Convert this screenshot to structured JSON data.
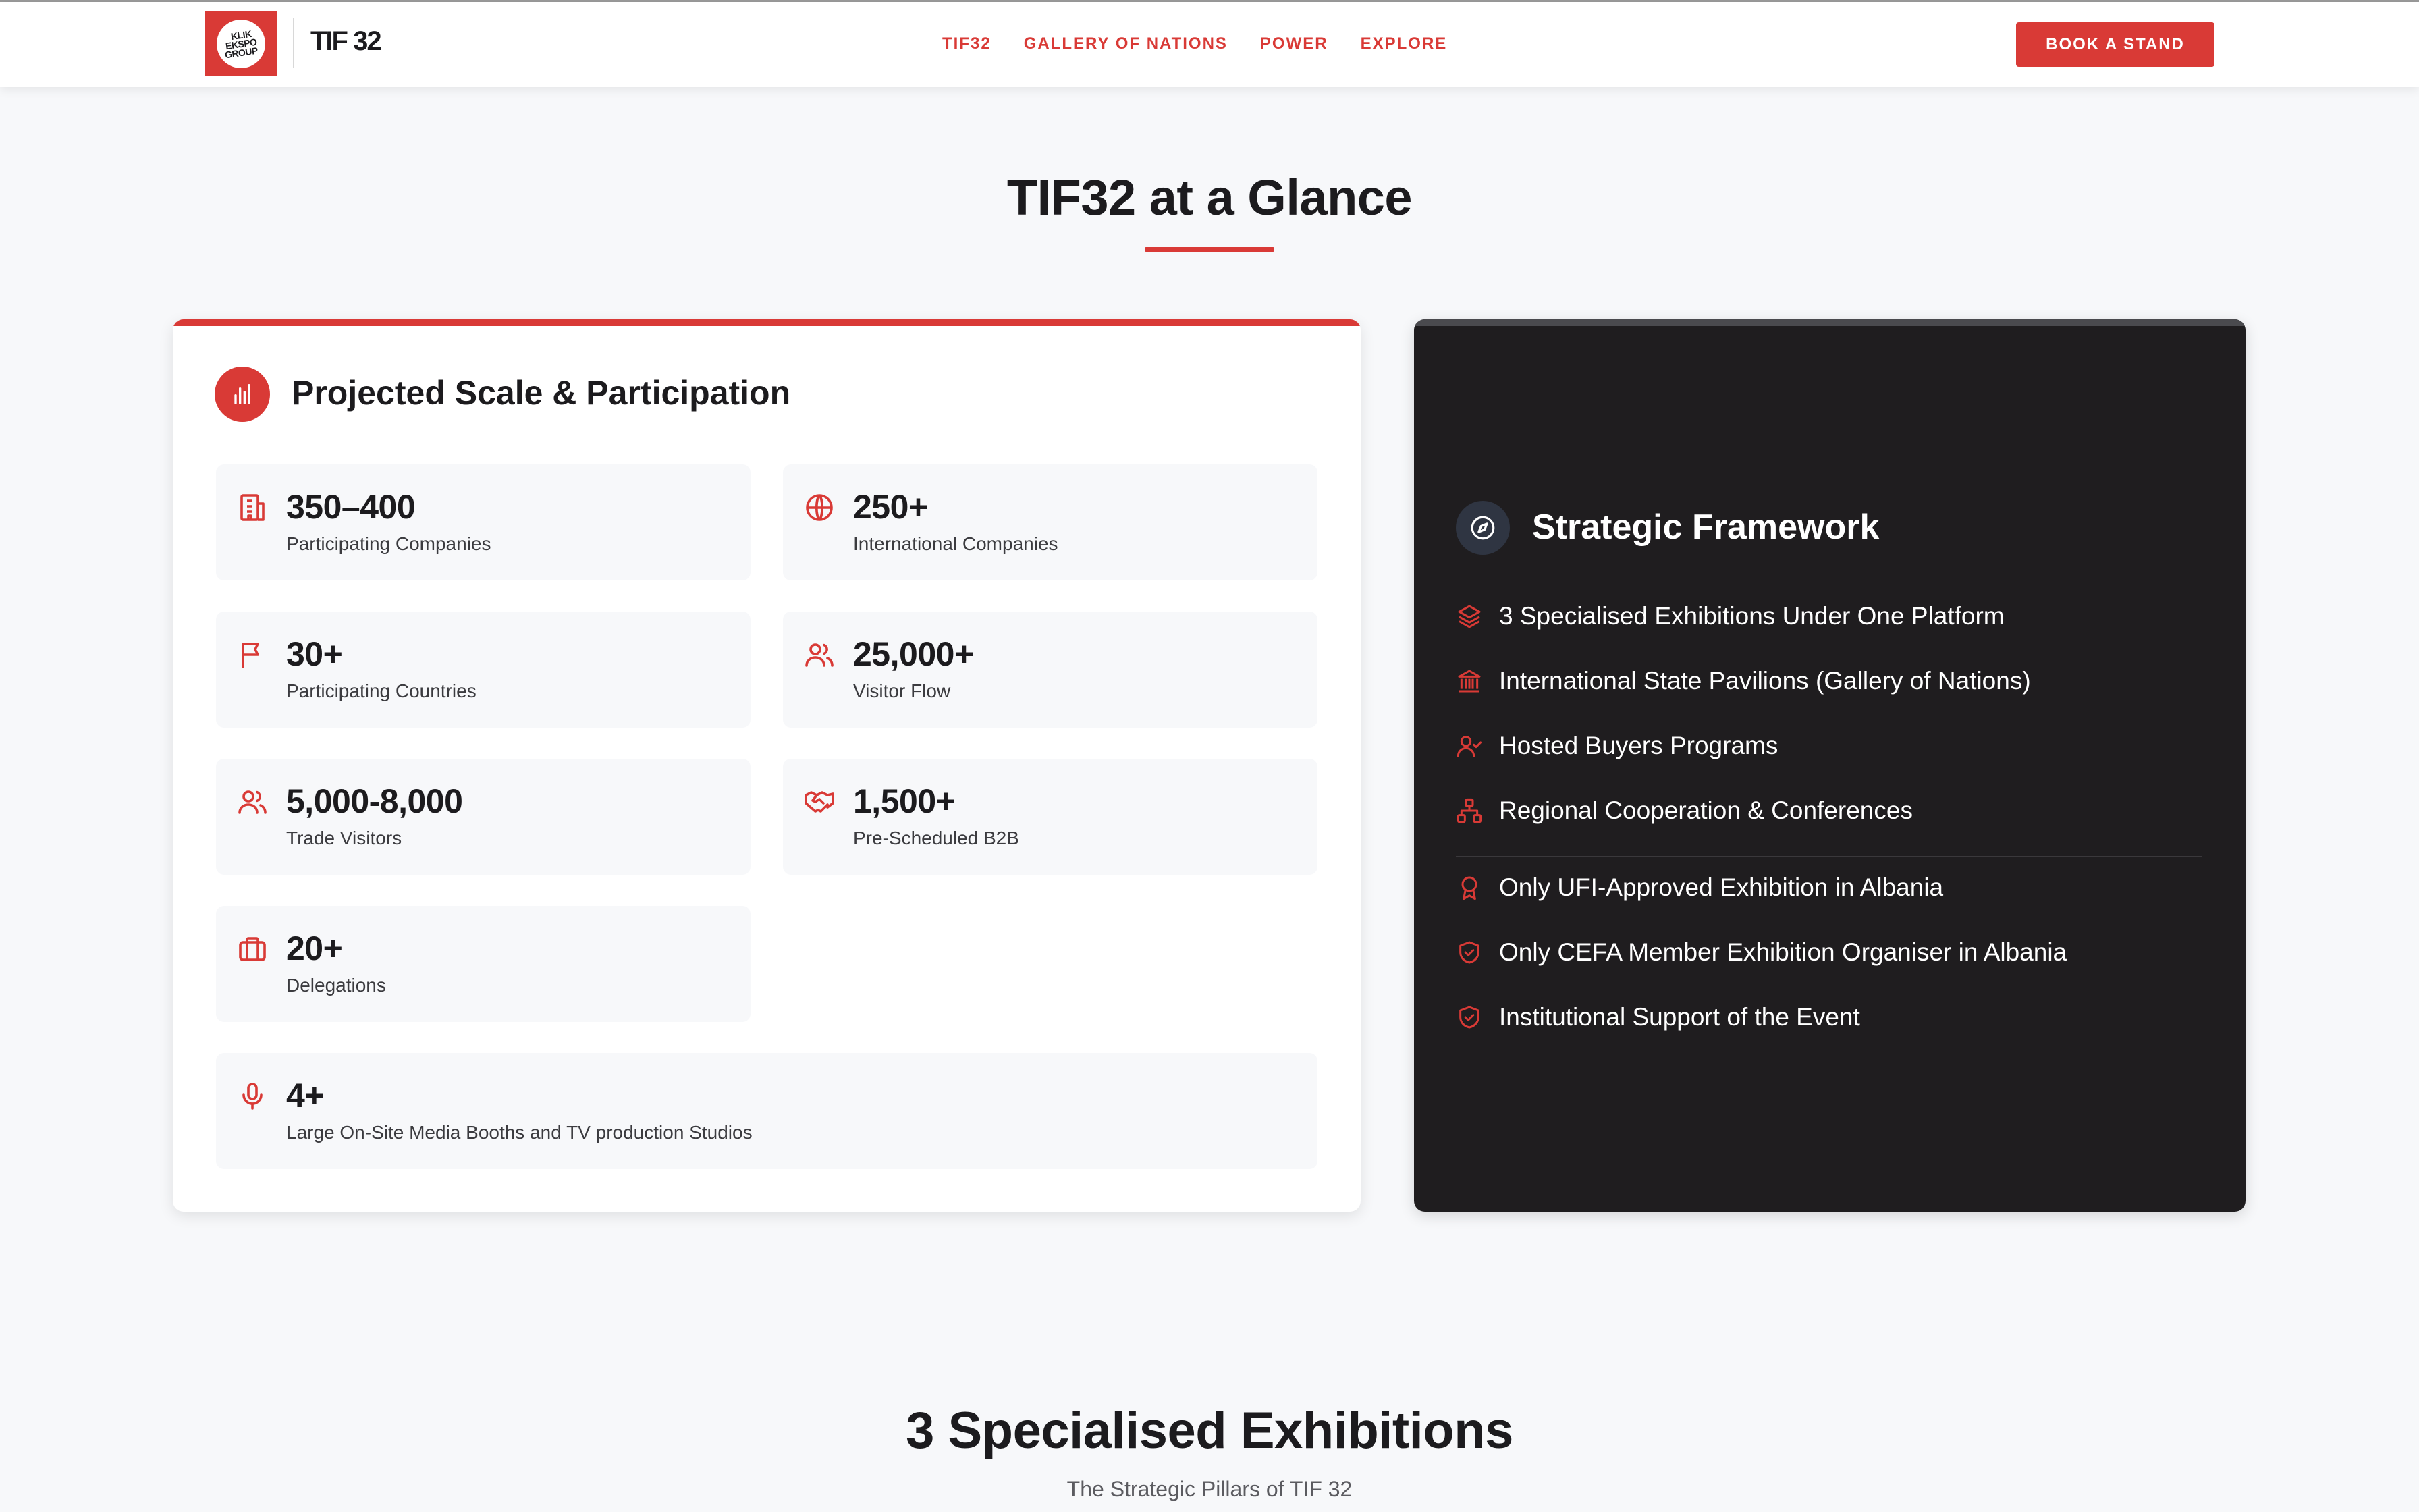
{
  "header": {
    "logo_lines": [
      "KLIK",
      "EKSPO",
      "GROUP"
    ],
    "brand": "TIF 32",
    "nav": [
      "TIF32",
      "GALLERY OF NATIONS",
      "POWER",
      "EXPLORE"
    ],
    "cta": "BOOK A STAND"
  },
  "glance": {
    "title": "TIF32 at a Glance",
    "accent_color": "#d93a36"
  },
  "scale_card": {
    "title": "Projected Scale & Participation",
    "icon": "bar-chart-icon",
    "stats": [
      {
        "value": "350–400",
        "label": "Participating Companies",
        "icon": "building-icon"
      },
      {
        "value": "250+",
        "label": "International Companies",
        "icon": "globe-icon"
      },
      {
        "value": "30+",
        "label": "Participating Countries",
        "icon": "flag-icon"
      },
      {
        "value": "25,000+",
        "label": "Visitor Flow",
        "icon": "users-icon"
      },
      {
        "value": "5,000-8,000",
        "label": "Trade Visitors",
        "icon": "users-icon"
      },
      {
        "value": "1,500+",
        "label": "Pre-Scheduled B2B",
        "icon": "handshake-icon"
      },
      {
        "value": "20+",
        "label": "Delegations",
        "icon": "briefcase-icon"
      },
      {
        "value": "4+",
        "label": "Large On-Site Media Booths and TV production Studios",
        "icon": "microphone-icon"
      }
    ]
  },
  "framework_card": {
    "title": "Strategic Framework",
    "icon": "compass-icon",
    "items": [
      {
        "text": "3 Specialised Exhibitions Under One Platform",
        "icon": "layers-icon"
      },
      {
        "text": "International State Pavilions (Gallery of Nations)",
        "icon": "landmark-icon"
      },
      {
        "text": "Hosted Buyers Programs",
        "icon": "user-check-icon"
      },
      {
        "text": "Regional Cooperation & Conferences",
        "icon": "network-icon"
      }
    ],
    "credentials": [
      {
        "text": "Only UFI-Approved Exhibition in Albania",
        "icon": "award-icon"
      },
      {
        "text": "Only CEFA Member Exhibition Organiser in Albania",
        "icon": "shield-check-icon"
      },
      {
        "text": "Institutional Support of the Event",
        "icon": "shield-check-icon"
      }
    ]
  },
  "exhibitions": {
    "title": "3 Specialised Exhibitions",
    "subtitle": "The Strategic Pillars of TIF 32"
  }
}
